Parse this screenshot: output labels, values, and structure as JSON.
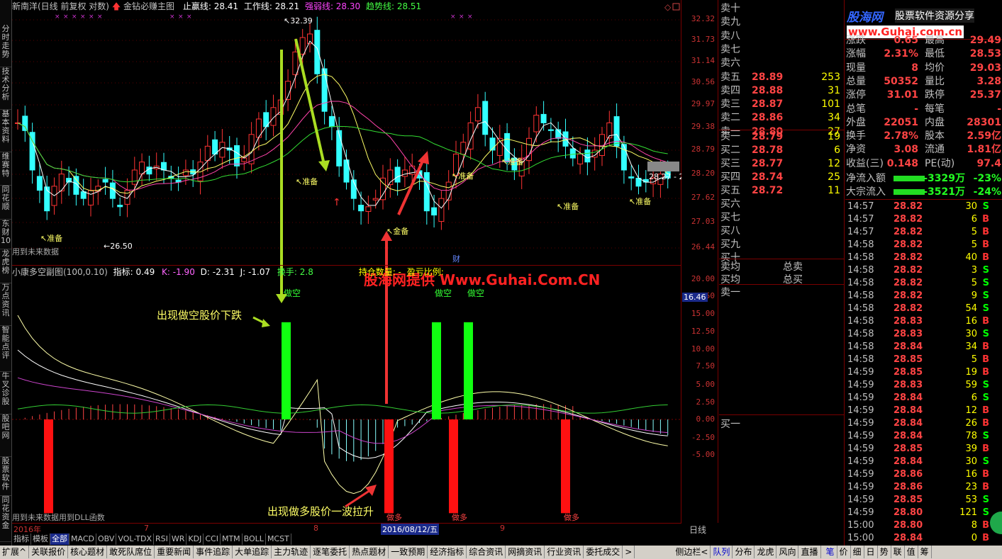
{
  "header": {
    "stock": "新南洋(日线 前复权 对数)",
    "formula": "金钻必赚主图",
    "stop_profit": "止赢线: 28.41",
    "work_line": "工作线: 28.21",
    "weak_line": "强弱线: 28.30",
    "trend_line": "趋势线: 28.51"
  },
  "left_sidebar": [
    "分时走势",
    "技术分析",
    "基本资料",
    "维赛特",
    "同花顺",
    "东财10",
    "龙虎榜",
    "万点资讯",
    "智能点评",
    "牛叉诊股",
    "股吧网",
    "股票软件",
    "同花资金"
  ],
  "price_axis": [
    "32.32",
    "31.73",
    "31.14",
    "30.56",
    "29.97",
    "29.38",
    "28.79",
    "28.20",
    "27.62",
    "27.03",
    "26.44"
  ],
  "indicator_axis": [
    "20.00",
    "17.50",
    "15.00",
    "12.50",
    "10.00",
    "7.50",
    "5.00",
    "2.50",
    "0.00",
    "-2.50",
    "-5.00"
  ],
  "indicator_current": "16.46",
  "price_labels": {
    "high": "32.39",
    "low": "26.50",
    "current": "28.27 - 2",
    "future_note": "用到未来数据",
    "finance_mark": "财"
  },
  "annotations": {
    "prepare": "准备",
    "prepare_alt": "金备",
    "short_label": "做空",
    "long_label": "做多",
    "fall_text": "出现做空股价下跌",
    "rise_text": "出现做多股价一波拉升",
    "watermark": "股海网提供 Www.Guhai.Com.CN"
  },
  "indicator_header": {
    "name": "小康多空副图(100,0.10)",
    "index": "指标: 0.49",
    "k": "K: -1.90",
    "d": "D: -2.31",
    "j": "J: -1.07",
    "turnover": "换手: 2.8",
    "position": "持仓数量: -",
    "profit": "盈亏比例:"
  },
  "indicator_footer": "用到未来数据用到DLL函数",
  "x_axis": {
    "year": "2016年",
    "m7": "7",
    "m8": "8",
    "date": "2016/08/12/五",
    "m9": "9",
    "period": "日线"
  },
  "indicator_tabs": [
    "指标",
    "模板",
    "全部",
    "MACD",
    "OBV",
    "VOL-TDX",
    "RSI",
    "WR",
    "KDJ",
    "CCI",
    "MTM",
    "BOLL",
    "MCST"
  ],
  "bottom_tabs": [
    "扩展^",
    "关联报价",
    "核心题材",
    "敢死队席位",
    "重要新闻",
    "事件追踪",
    "大单追踪",
    "主力轨迹",
    "逐笔委托",
    "热点题材",
    "一致预期",
    "经济指标",
    "综合资讯",
    "网摘资讯",
    "行业资讯",
    "委托成交",
    ">",
    "侧边栏<",
    "队列",
    "分布",
    "龙虎",
    "风向",
    "直播",
    "笔",
    "价",
    "细",
    "日",
    "势",
    "联",
    "值",
    "筹"
  ],
  "order_book": {
    "sell": [
      {
        "label": "卖十",
        "price": "",
        "vol": ""
      },
      {
        "label": "卖九",
        "price": "",
        "vol": ""
      },
      {
        "label": "卖八",
        "price": "",
        "vol": ""
      },
      {
        "label": "卖七",
        "price": "",
        "vol": ""
      },
      {
        "label": "卖六",
        "price": "",
        "vol": ""
      },
      {
        "label": "卖五",
        "price": "28.89",
        "vol": "253"
      },
      {
        "label": "卖四",
        "price": "28.88",
        "vol": "31"
      },
      {
        "label": "卖三",
        "price": "28.87",
        "vol": "101"
      },
      {
        "label": "卖二",
        "price": "28.86",
        "vol": "34"
      },
      {
        "label": "卖一",
        "price": "28.80",
        "vol": "27"
      }
    ],
    "buy": [
      {
        "label": "买一",
        "price": "28.79",
        "vol": "19"
      },
      {
        "label": "买二",
        "price": "28.78",
        "vol": "6"
      },
      {
        "label": "买三",
        "price": "28.77",
        "vol": "12"
      },
      {
        "label": "买四",
        "price": "28.74",
        "vol": "25"
      },
      {
        "label": "买五",
        "price": "28.72",
        "vol": "11"
      },
      {
        "label": "买六",
        "price": "",
        "vol": ""
      },
      {
        "label": "买七",
        "price": "",
        "vol": ""
      },
      {
        "label": "买八",
        "price": "",
        "vol": ""
      },
      {
        "label": "买九",
        "price": "",
        "vol": ""
      },
      {
        "label": "买十",
        "price": "",
        "vol": ""
      }
    ],
    "avg_sell": "卖均",
    "avg_buy": "买均",
    "total_sell": "总卖",
    "total_buy": "总买",
    "queue_sell": "卖一",
    "queue_buy": "买一"
  },
  "logo": {
    "name": "股海网",
    "slogan": "股票软件资源分享",
    "url": "www.Guhai.com.cn"
  },
  "quote": [
    {
      "l1": "涨跌",
      "v1": "0.65",
      "l2": "最高",
      "v2": "29.49"
    },
    {
      "l1": "涨幅",
      "v1": "2.31%",
      "l2": "最低",
      "v2": "28.53"
    },
    {
      "l1": "现量",
      "v1": "8",
      "l2": "均价",
      "v2": "29.03"
    },
    {
      "l1": "总量",
      "v1": "50352",
      "l2": "量比",
      "v2": "3.28"
    },
    {
      "l1": "涨停",
      "v1": "31.01",
      "l2": "跌停",
      "v2": "25.37"
    },
    {
      "l1": "总笔",
      "v1": "-",
      "l2": "每笔",
      "v2": "-"
    },
    {
      "l1": "外盘",
      "v1": "22051",
      "l2": "内盘",
      "v2": "28301"
    },
    {
      "l1": "换手",
      "v1": "2.78%",
      "l2": "股本",
      "v2": "2.59亿"
    },
    {
      "l1": "净资",
      "v1": "3.08",
      "l2": "流通",
      "v2": "1.81亿"
    },
    {
      "l1": "收益(三)",
      "v1": "0.148",
      "l2": "PE(动)",
      "v2": "97.4"
    }
  ],
  "money_flow": [
    {
      "label": "净流入额",
      "value": "-3329万",
      "pct": "-23%"
    },
    {
      "label": "大宗流入",
      "value": "-3521万",
      "pct": "-24%"
    }
  ],
  "ticks": [
    {
      "t": "14:57",
      "p": "28.82",
      "v": "30",
      "f": "S"
    },
    {
      "t": "14:57",
      "p": "28.82",
      "v": "6",
      "f": "B"
    },
    {
      "t": "14:57",
      "p": "28.82",
      "v": "5",
      "f": "B"
    },
    {
      "t": "14:58",
      "p": "28.82",
      "v": "5",
      "f": "B"
    },
    {
      "t": "14:58",
      "p": "28.82",
      "v": "40",
      "f": "B"
    },
    {
      "t": "14:58",
      "p": "28.82",
      "v": "3",
      "f": "S"
    },
    {
      "t": "14:58",
      "p": "28.82",
      "v": "5",
      "f": "S"
    },
    {
      "t": "14:58",
      "p": "28.82",
      "v": "9",
      "f": "S"
    },
    {
      "t": "14:58",
      "p": "28.82",
      "v": "54",
      "f": "S"
    },
    {
      "t": "14:58",
      "p": "28.83",
      "v": "16",
      "f": "B"
    },
    {
      "t": "14:58",
      "p": "28.83",
      "v": "30",
      "f": "S"
    },
    {
      "t": "14:58",
      "p": "28.84",
      "v": "34",
      "f": "B"
    },
    {
      "t": "14:58",
      "p": "28.85",
      "v": "5",
      "f": "B"
    },
    {
      "t": "14:59",
      "p": "28.85",
      "v": "19",
      "f": "B"
    },
    {
      "t": "14:59",
      "p": "28.83",
      "v": "59",
      "f": "S"
    },
    {
      "t": "14:59",
      "p": "28.84",
      "v": "6",
      "f": "S"
    },
    {
      "t": "14:59",
      "p": "28.84",
      "v": "12",
      "f": "B"
    },
    {
      "t": "14:59",
      "p": "28.84",
      "v": "26",
      "f": "B"
    },
    {
      "t": "14:59",
      "p": "28.84",
      "v": "78",
      "f": "S"
    },
    {
      "t": "14:59",
      "p": "28.85",
      "v": "39",
      "f": "B"
    },
    {
      "t": "14:59",
      "p": "28.84",
      "v": "30",
      "f": "S"
    },
    {
      "t": "14:59",
      "p": "28.86",
      "v": "16",
      "f": "B"
    },
    {
      "t": "14:59",
      "p": "28.86",
      "v": "23",
      "f": "B"
    },
    {
      "t": "14:59",
      "p": "28.85",
      "v": "53",
      "f": "S"
    },
    {
      "t": "14:59",
      "p": "28.80",
      "v": "121",
      "f": "S"
    },
    {
      "t": "15:00",
      "p": "28.80",
      "v": "8",
      "f": "B"
    },
    {
      "t": "15:00",
      "p": "28.84",
      "v": "0",
      "f": "B"
    }
  ],
  "colors": {
    "up": "#ff3333",
    "down": "#33ffff",
    "buy": "#ff3333",
    "sell": "#00ff00",
    "accent": "#ffff00"
  }
}
